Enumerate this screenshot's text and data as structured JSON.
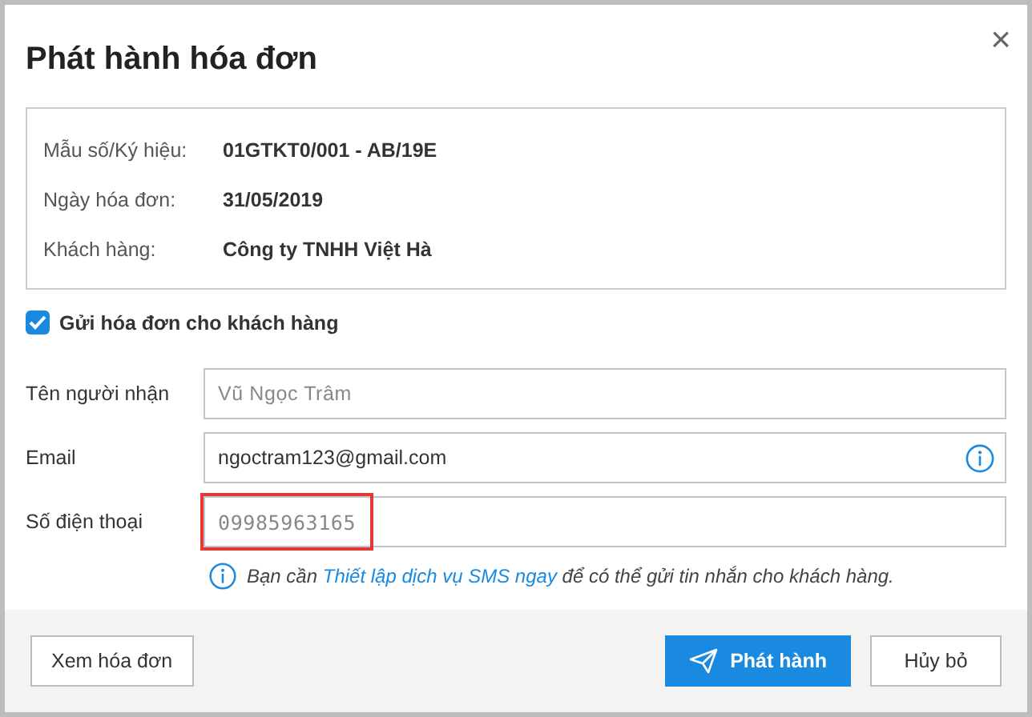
{
  "dialog": {
    "title": "Phát hành hóa đơn",
    "close": "×"
  },
  "info": [
    {
      "label": "Mẫu số/Ký hiệu:",
      "value": "01GTKT0/001 - AB/19E"
    },
    {
      "label": "Ngày hóa đơn:",
      "value": "31/05/2019"
    },
    {
      "label": "Khách hàng:",
      "value": "Công ty TNHH Việt Hà"
    }
  ],
  "send_checkbox": {
    "label": "Gửi hóa đơn cho khách hàng",
    "checked": true
  },
  "fields": [
    {
      "label": "Tên người nhận",
      "placeholder": "Vũ Ngọc Trâm"
    },
    {
      "label": "Email",
      "value": "ngoctram123@gmail.com",
      "info_icon": true
    },
    {
      "label": "Số điện thoại",
      "placeholder": "09985963165",
      "highlighted": true
    }
  ],
  "note": {
    "before": "Bạn cần",
    "link": "Thiết lập dịch vụ SMS ngay",
    "after": "để có thể gửi tin nhắn cho khách hàng."
  },
  "buttons": [
    {
      "label": "Xem hóa đơn",
      "kind": "secondary"
    },
    {
      "label": "Phát hành",
      "kind": "primary"
    },
    {
      "label": "Hủy bỏ",
      "kind": "secondary"
    }
  ]
}
